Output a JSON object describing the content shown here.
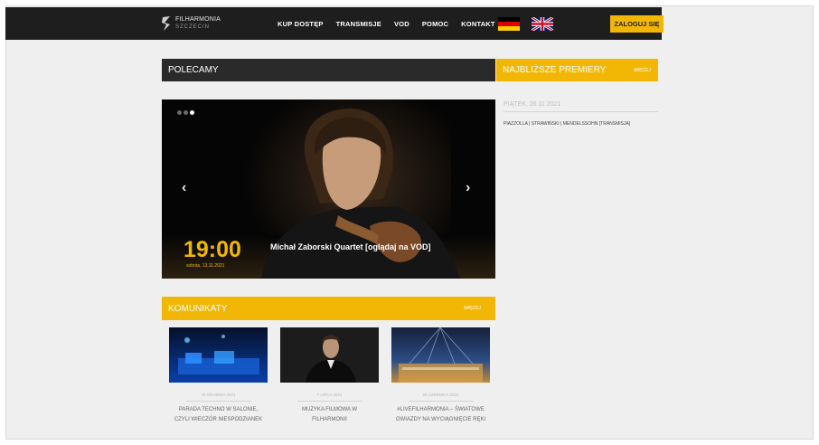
{
  "header": {
    "logo": {
      "line1": "FILHARMONIA",
      "line2": "SZCZECIN"
    },
    "nav": [
      "KUP DOSTĘP",
      "TRANSMISJE",
      "VOD",
      "POMOC",
      "KONTAKT"
    ],
    "languages": [
      "de-flag",
      "uk-flag"
    ],
    "login_label": "ZALOGUJ SIĘ",
    "colors": {
      "bar": "#1e1e1e",
      "accent": "#f2b705"
    }
  },
  "polecamy": {
    "title": "POLECAMY"
  },
  "premiery": {
    "title": "NAJBLIŻSZE PREMIERY",
    "more": "WIĘCEJ",
    "date": "PIĄTEK, 26.11.2021",
    "item": "PIAZZOLLA | STRAWIŃSKI | MENDELSSOHN [TRANSMISJA]"
  },
  "slider": {
    "time": "19:00",
    "date": "sobota, 13.11.2021",
    "title": "Michał Zaborski Quartet [oglądaj na VOD]",
    "slides_count": 3,
    "active_slide": 1,
    "prev_icon": "chevron-left-icon",
    "next_icon": "chevron-right-icon"
  },
  "komunikaty": {
    "title": "KOMUNIKATY",
    "more": "WIĘCEJ",
    "items": [
      {
        "date": "19 GRUDNIA 2021",
        "title": "PARADA TECHNO W SALONIE, CZYLI WIECZÓR NIESPODZIANEK"
      },
      {
        "date": "7 LIPCA 2021",
        "title": "MUZYKA FILMOWA W FILHARMONII"
      },
      {
        "date": "25 CZERWCA 2021",
        "title": "#LIVEFILHARMONIA – ŚWIATOWE GWIAZDY NA WYCIĄGNIĘCIE RĘKI"
      }
    ]
  }
}
